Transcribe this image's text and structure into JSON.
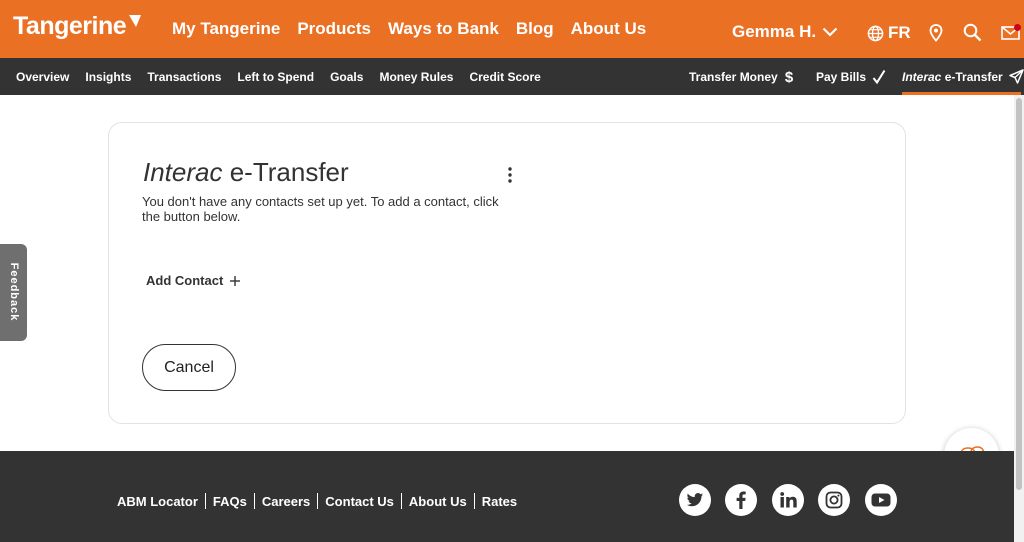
{
  "brand": {
    "name": "Tangerine",
    "accent": "#ea7024",
    "dark": "#333333"
  },
  "header": {
    "main_nav": [
      "My Tangerine",
      "Products",
      "Ways to Bank",
      "Blog",
      "About Us"
    ],
    "user_name": "Gemma H.",
    "language": "FR",
    "icons": [
      "globe-icon",
      "location-pin-icon",
      "search-icon",
      "mail-icon"
    ]
  },
  "subnav": {
    "items": [
      "Overview",
      "Insights",
      "Transactions",
      "Left to Spend",
      "Goals",
      "Money Rules",
      "Credit Score"
    ],
    "transfer_money": "Transfer Money",
    "pay_bills": "Pay Bills",
    "etransfer_italic": "Interac",
    "etransfer_rest": " e-Transfer"
  },
  "feedback_label": "Feedback",
  "card": {
    "title_italic": "Interac",
    "title_rest": " e-Transfer",
    "description": "You don't have any contacts set up yet. To add a contact, click the button below.",
    "add_contact": "Add Contact",
    "cancel": "Cancel"
  },
  "footer": {
    "links": [
      "ABM Locator",
      "FAQs",
      "Careers",
      "Contact Us",
      "About Us",
      "Rates"
    ],
    "social": [
      "twitter-icon",
      "facebook-icon",
      "linkedin-icon",
      "instagram-icon",
      "youtube-icon"
    ]
  }
}
